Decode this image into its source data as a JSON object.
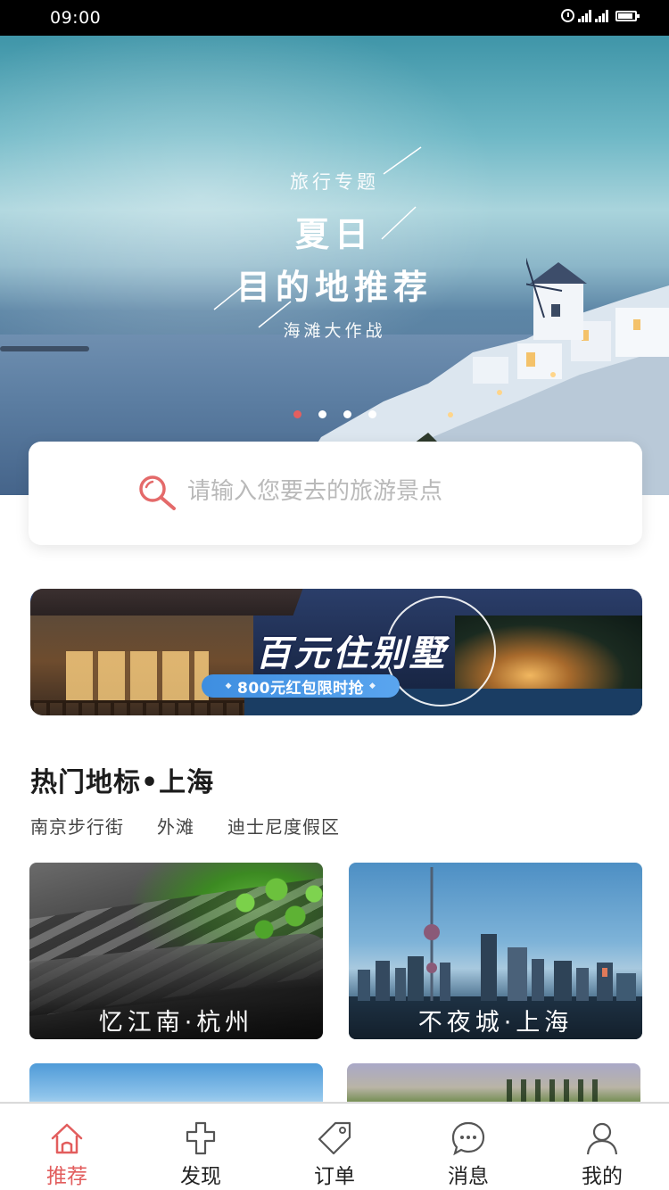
{
  "status_bar": {
    "time": "09:00"
  },
  "hero": {
    "kicker": "旅行专题",
    "title_line1": "夏日",
    "title_line2": "目的地推荐",
    "subtitle": "海滩大作战",
    "carousel_total": 4,
    "carousel_active": 1
  },
  "search": {
    "placeholder": "请输入您要去的旅游景点",
    "value": ""
  },
  "promo": {
    "title": "百元住别墅",
    "tagline": "800元红包限时抢"
  },
  "hot_section": {
    "title": "热门地标•上海",
    "tags": [
      "南京步行街",
      "外滩",
      "迪士尼度假区"
    ],
    "cards": [
      {
        "label": "忆江南·杭州"
      },
      {
        "label": "不夜城·上海"
      }
    ]
  },
  "tabbar": {
    "items": [
      {
        "label": "推荐",
        "icon": "home-icon"
      },
      {
        "label": "发现",
        "icon": "discover-icon"
      },
      {
        "label": "订单",
        "icon": "order-tag-icon"
      },
      {
        "label": "消息",
        "icon": "message-icon"
      },
      {
        "label": "我的",
        "icon": "profile-icon"
      }
    ],
    "active_index": 0
  },
  "colors": {
    "accent": "#e25d5d",
    "pill": "#4a9be6",
    "text_dark": "#1c1c1c",
    "placeholder": "#b9b9b9"
  }
}
